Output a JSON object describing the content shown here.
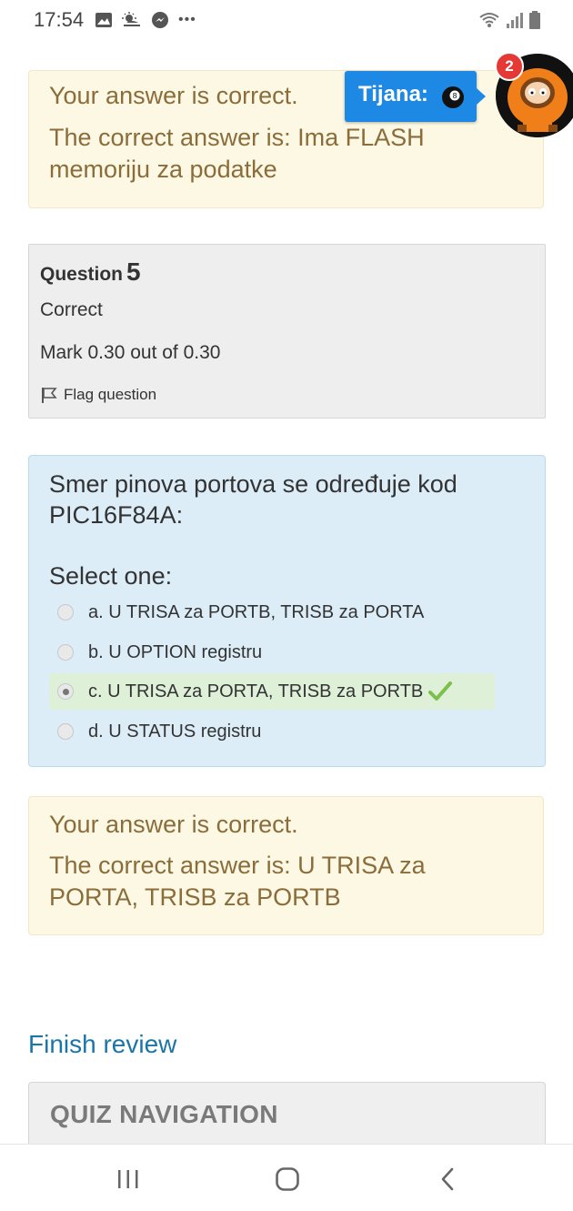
{
  "status_bar": {
    "time": "17:54",
    "more": "•••"
  },
  "feedback_top": {
    "line1": "Your answer is correct.",
    "line2": "The correct answer is: Ima FLASH",
    "line3": "memoriju za podatke"
  },
  "chat_head": {
    "name": "Tijana:",
    "badge_count": "2",
    "color": "#1e88e5"
  },
  "question": {
    "label": "Question",
    "number": "5",
    "state": "Correct",
    "mark": "Mark 0.30 out of 0.30",
    "flag_label": "Flag question"
  },
  "content": {
    "text_line1": "Smer pinova portova se određuje kod",
    "text_line2": "PIC16F84A:",
    "prompt": "Select one:",
    "answers": [
      {
        "label": "a. U TRISA za PORTB, TRISB za PORTA",
        "selected": false
      },
      {
        "label": "b. U OPTION registru",
        "selected": false
      },
      {
        "label": "c. U TRISA za PORTA, TRISB za PORTB",
        "selected": true,
        "correct": true
      },
      {
        "label": "d. U STATUS registru",
        "selected": false
      }
    ]
  },
  "feedback_bottom": {
    "line1": "Your answer is correct.",
    "line2": "The correct answer is: U TRISA za",
    "line3": "PORTA, TRISB za PORTB"
  },
  "finish_review": "Finish review",
  "quiz_navigation": "QUIZ NAVIGATION",
  "colors": {
    "feedback_bg": "#fcf8e3",
    "feedback_text": "#8a6d3b",
    "content_bg": "#dcedf7",
    "correct_bg": "#dff0d8",
    "check": "#7cc04b",
    "link": "#1a75a8"
  },
  "icons": [
    "gallery-icon",
    "weather-icon",
    "messenger-icon",
    "wifi-icon",
    "signal-icon",
    "battery-icon",
    "flag-icon",
    "check-icon",
    "recent-apps-icon",
    "home-icon",
    "back-icon"
  ]
}
